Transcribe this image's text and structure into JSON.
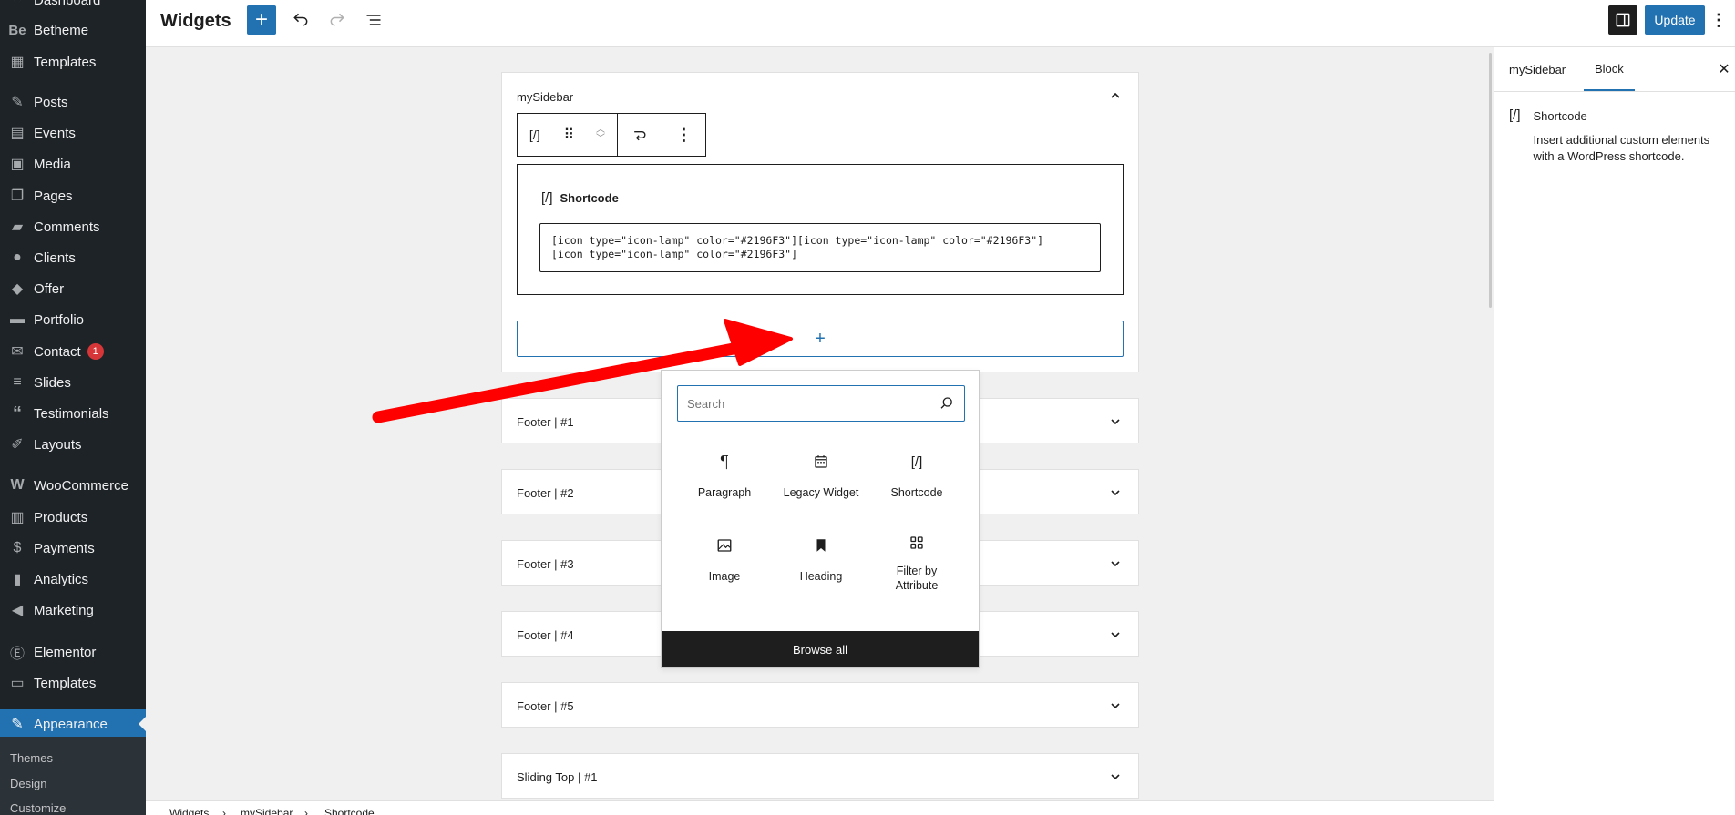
{
  "admin_menu": {
    "items": [
      {
        "label": "Dashboard",
        "icon": "dashboard-icon"
      },
      {
        "label": "Betheme",
        "icon": "betheme-icon"
      },
      {
        "label": "Templates",
        "icon": "templates-icon"
      },
      {
        "label": "Posts",
        "icon": "pin-icon"
      },
      {
        "label": "Events",
        "icon": "events-icon"
      },
      {
        "label": "Media",
        "icon": "media-icon"
      },
      {
        "label": "Pages",
        "icon": "pages-icon"
      },
      {
        "label": "Comments",
        "icon": "comments-icon"
      },
      {
        "label": "Clients",
        "icon": "clients-icon"
      },
      {
        "label": "Offer",
        "icon": "offer-icon"
      },
      {
        "label": "Portfolio",
        "icon": "portfolio-icon"
      },
      {
        "label": "Contact",
        "icon": "mail-icon",
        "badge": "1"
      },
      {
        "label": "Slides",
        "icon": "slides-icon"
      },
      {
        "label": "Testimonials",
        "icon": "quote-icon"
      },
      {
        "label": "Layouts",
        "icon": "layouts-icon"
      },
      {
        "label": "WooCommerce",
        "icon": "woo-icon"
      },
      {
        "label": "Products",
        "icon": "products-icon"
      },
      {
        "label": "Payments",
        "icon": "payments-icon"
      },
      {
        "label": "Analytics",
        "icon": "analytics-icon"
      },
      {
        "label": "Marketing",
        "icon": "marketing-icon"
      },
      {
        "label": "Elementor",
        "icon": "elementor-icon"
      },
      {
        "label": "Templates",
        "icon": "folder-icon"
      },
      {
        "label": "Appearance",
        "icon": "brush-icon"
      }
    ],
    "submenu": [
      "Themes",
      "Design",
      "Customize"
    ]
  },
  "header": {
    "title": "Widgets",
    "update_label": "Update"
  },
  "widget_area": {
    "title": "mySidebar",
    "block_label": "Shortcode",
    "shortcode_lines": "[icon type=\"icon-lamp\" color=\"#2196F3\"][icon type=\"icon-lamp\" color=\"#2196F3\"]\n[icon type=\"icon-lamp\" color=\"#2196F3\"]",
    "shortcode_icon": "[/]"
  },
  "other_areas": [
    "Footer | #1",
    "Footer | #2",
    "Footer | #3",
    "Footer | #4",
    "Footer | #5",
    "Sliding Top | #1"
  ],
  "inserter": {
    "search_placeholder": "Search",
    "blocks": [
      {
        "label": "Paragraph",
        "icon": "paragraph-icon"
      },
      {
        "label": "Legacy Widget",
        "icon": "calendar-icon"
      },
      {
        "label": "Shortcode",
        "icon": "shortcode-icon"
      },
      {
        "label": "Image",
        "icon": "image-icon"
      },
      {
        "label": "Heading",
        "icon": "bookmark-icon"
      },
      {
        "label": "Filter by Attribute",
        "icon": "grid-icon"
      }
    ],
    "browse_all": "Browse all"
  },
  "sidebar": {
    "tabs": [
      "mySidebar",
      "Block"
    ],
    "active_tab": "Block",
    "block_title": "Shortcode",
    "block_description": "Insert additional custom elements with a WordPress shortcode."
  },
  "breadcrumb": [
    "Widgets",
    "mySidebar",
    "Shortcode"
  ],
  "colors": {
    "accent": "#2271b1",
    "admin_bg": "#1d2327",
    "arrow": "#ff0000"
  }
}
